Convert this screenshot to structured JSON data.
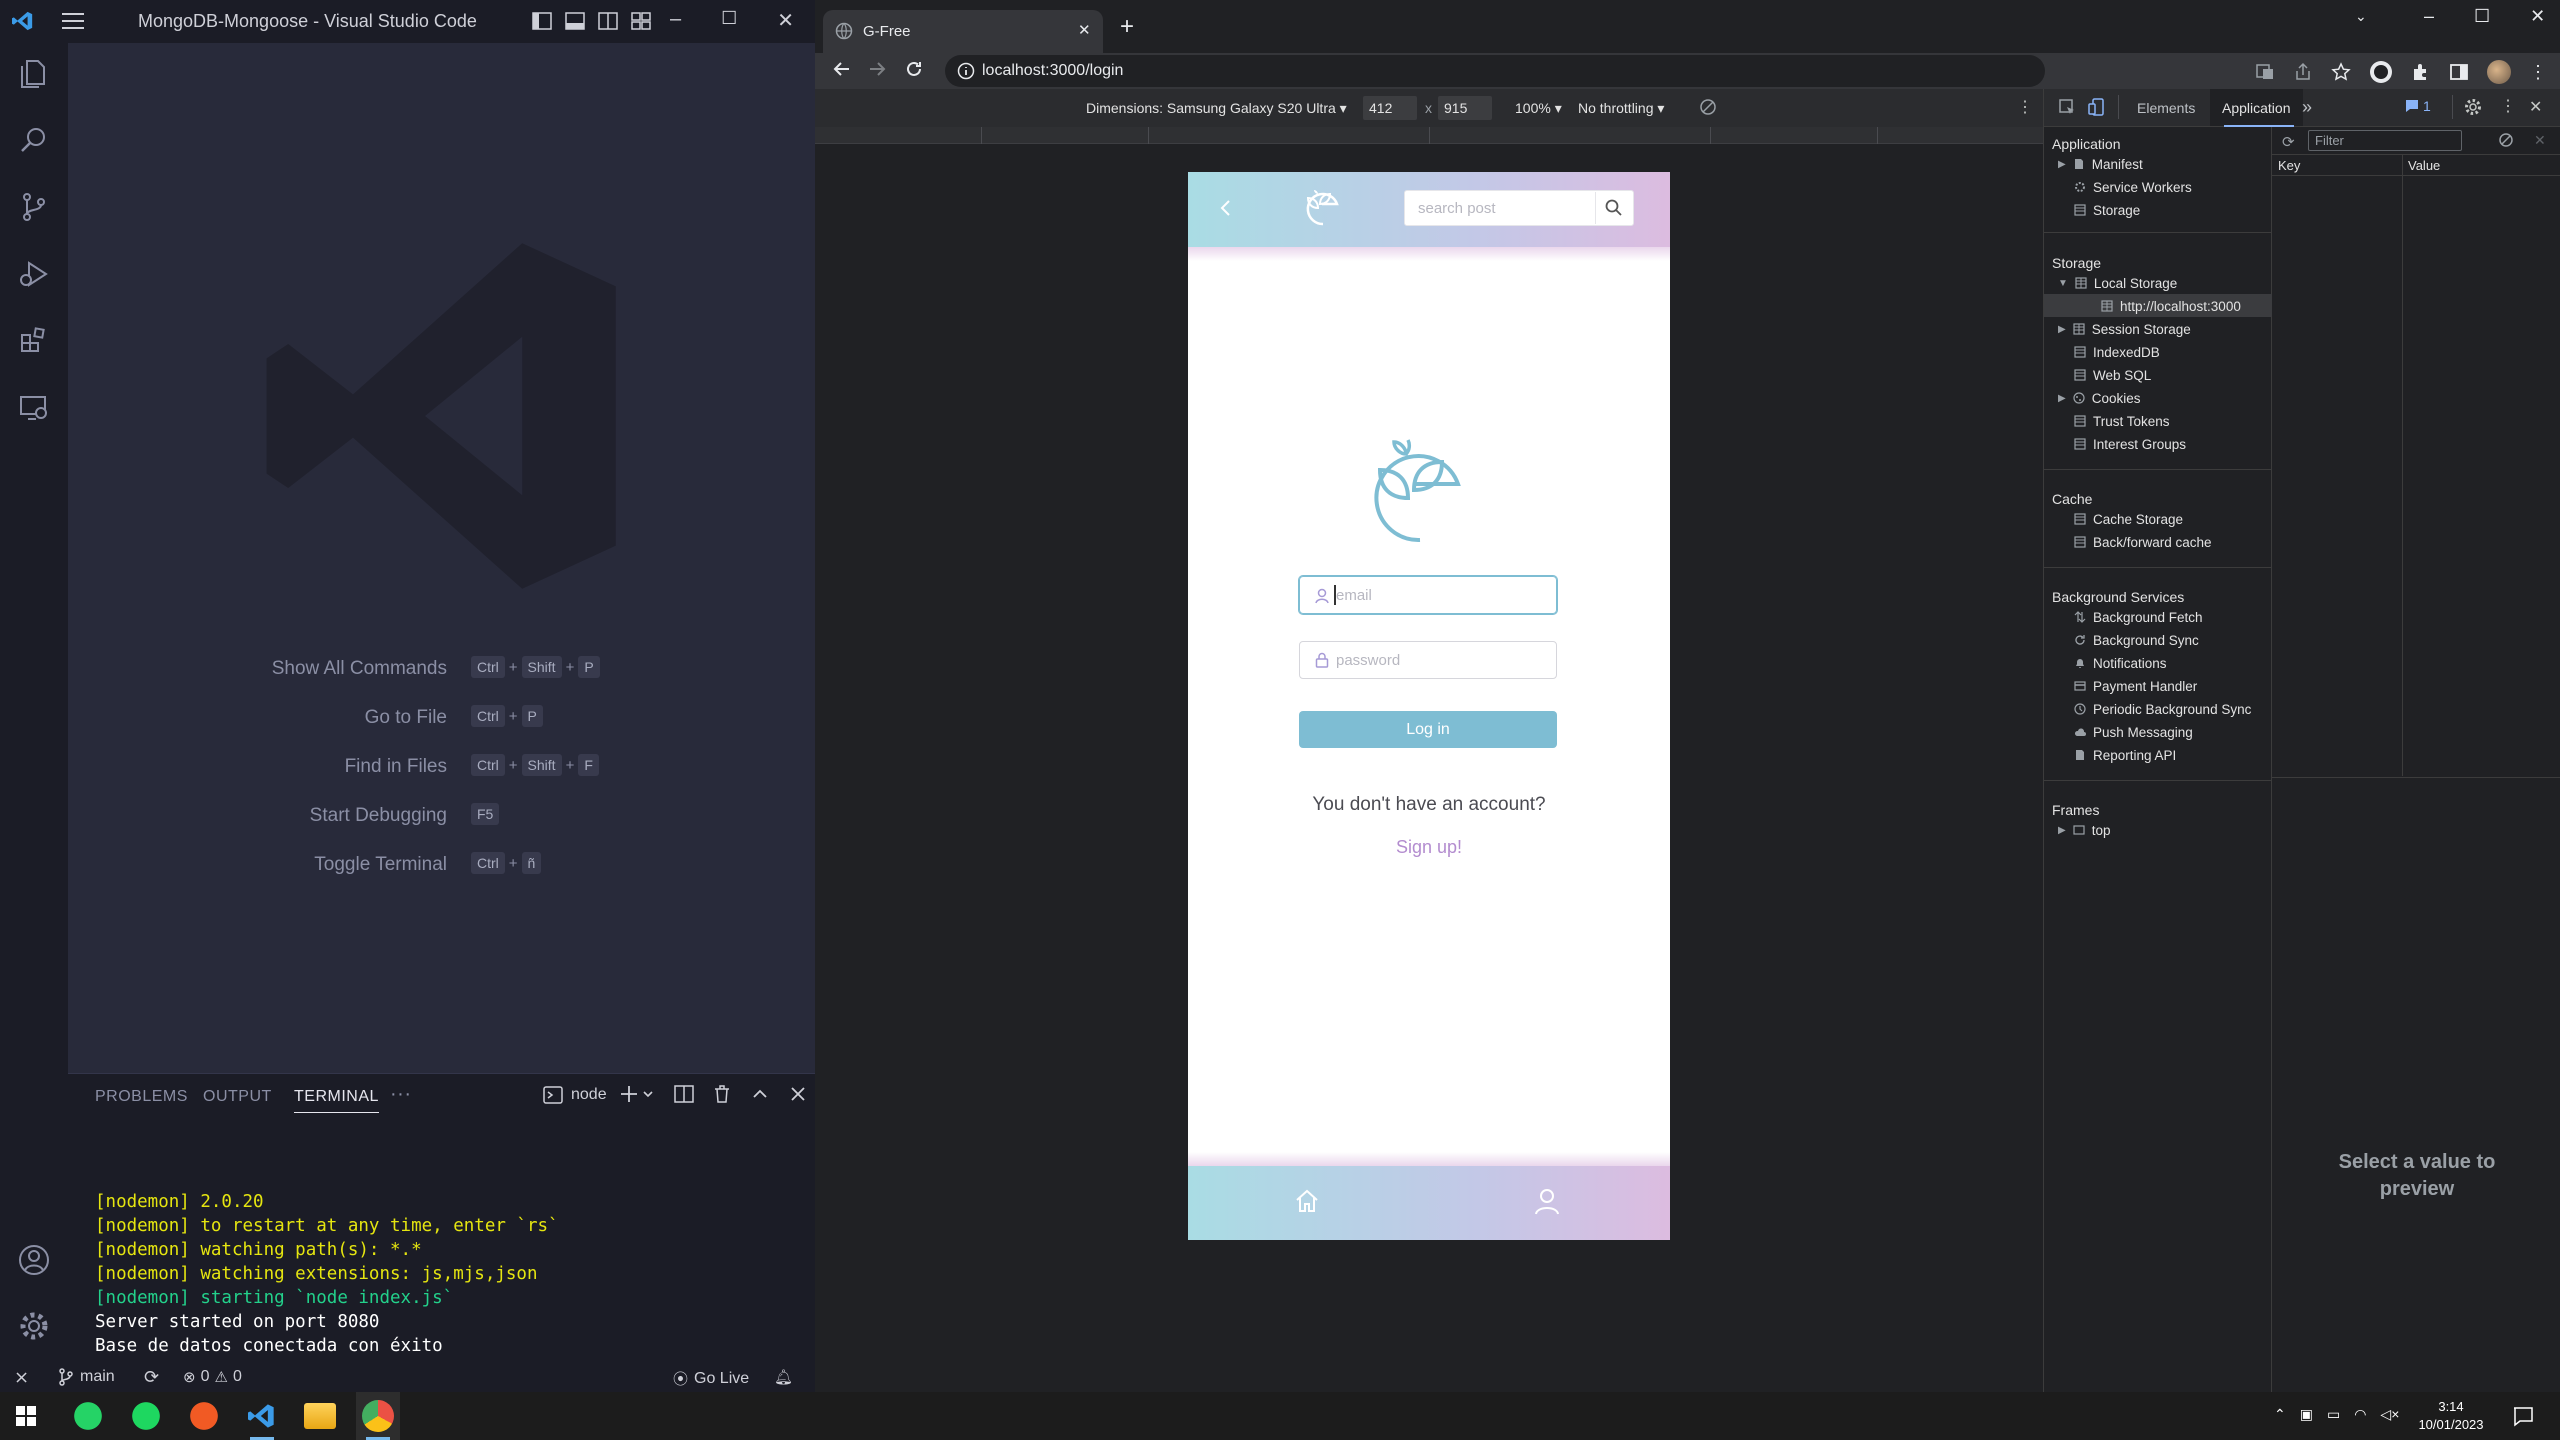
{
  "vscode": {
    "title": "MongoDB-Mongoose - Visual Studio Code",
    "commands": [
      {
        "label": "Show All Commands",
        "keys": [
          "Ctrl",
          "Shift",
          "P"
        ]
      },
      {
        "label": "Go to File",
        "keys": [
          "Ctrl",
          "P"
        ]
      },
      {
        "label": "Find in Files",
        "keys": [
          "Ctrl",
          "Shift",
          "F"
        ]
      },
      {
        "label": "Start Debugging",
        "keys": [
          "F5"
        ]
      },
      {
        "label": "Toggle Terminal",
        "keys": [
          "Ctrl",
          "ñ"
        ]
      }
    ],
    "panel": {
      "tabs": [
        "PROBLEMS",
        "OUTPUT",
        "TERMINAL"
      ],
      "active_tab": "TERMINAL",
      "more": "···",
      "terminal_name": "node"
    },
    "terminal_lines": [
      {
        "text": "[nodemon] 2.0.20",
        "color": "#e5e510"
      },
      {
        "text": "[nodemon] to restart at any time, enter `rs`",
        "color": "#e5e510"
      },
      {
        "text": "[nodemon] watching path(s): *.*",
        "color": "#e5e510"
      },
      {
        "text": "[nodemon] watching extensions: js,mjs,json",
        "color": "#e5e510"
      },
      {
        "text": "[nodemon] starting `node index.js`",
        "color": "#23d18b"
      },
      {
        "text": "Server started on port 8080",
        "color": "#ffffff"
      },
      {
        "text": "Base de datos conectada con éxito",
        "color": "#ffffff"
      }
    ],
    "status": {
      "branch": "main",
      "errors": "0",
      "warnings": "0",
      "go_live": "Go Live"
    }
  },
  "chrome": {
    "tab_title": "G-Free",
    "url": "localhost:3000/login",
    "device_toolbar": {
      "dimensions_label": "Dimensions: Samsung Galaxy S20 Ultra",
      "width": "412",
      "x": "x",
      "height": "915",
      "zoom": "100%",
      "throttling": "No throttling"
    },
    "app": {
      "search_placeholder": "search post",
      "email_placeholder": "email",
      "password_placeholder": "password",
      "login_label": "Log in",
      "no_account_text": "You don't have an account?",
      "signup_label": "Sign up!",
      "brand_color": "#7ebdd3",
      "signup_color": "#b38ccf"
    }
  },
  "devtools": {
    "tabs": [
      "Elements",
      "Application"
    ],
    "active_tab": "Application",
    "more": "»",
    "badge": "1",
    "sections": {
      "application": {
        "title": "Application",
        "items": [
          "Manifest",
          "Service Workers",
          "Storage"
        ]
      },
      "storage": {
        "title": "Storage",
        "local_storage": "Local Storage",
        "local_origin": "http://localhost:3000",
        "items": [
          "Session Storage",
          "IndexedDB",
          "Web SQL",
          "Cookies",
          "Trust Tokens",
          "Interest Groups"
        ]
      },
      "cache": {
        "title": "Cache",
        "items": [
          "Cache Storage",
          "Back/forward cache"
        ]
      },
      "background": {
        "title": "Background Services",
        "items": [
          "Background Fetch",
          "Background Sync",
          "Notifications",
          "Payment Handler",
          "Periodic Background Sync",
          "Push Messaging",
          "Reporting API"
        ]
      },
      "frames": {
        "title": "Frames",
        "items": [
          "top"
        ]
      }
    },
    "filter_placeholder": "Filter",
    "columns": [
      "Key",
      "Value"
    ],
    "preview_text": "Select a value to preview"
  },
  "taskbar": {
    "time": "3:14",
    "date": "10/01/2023"
  }
}
